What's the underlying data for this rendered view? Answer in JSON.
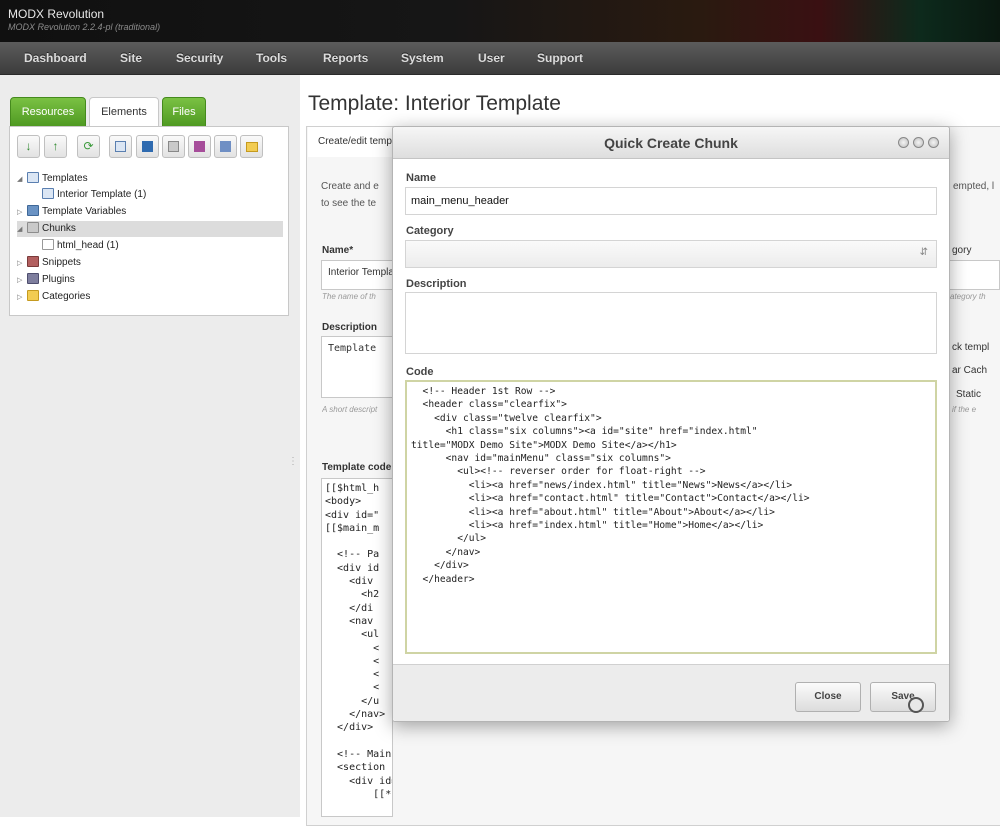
{
  "app": {
    "title": "MODX Revolution",
    "subtitle": "MODX Revolution 2.2.4-pl (traditional)"
  },
  "nav": {
    "items": [
      {
        "label": "Dashboard",
        "name": "nav-dashboard"
      },
      {
        "label": "Site",
        "name": "nav-site"
      },
      {
        "label": "Security",
        "name": "nav-security"
      },
      {
        "label": "Tools",
        "name": "nav-tools"
      },
      {
        "label": "Reports",
        "name": "nav-reports"
      },
      {
        "label": "System",
        "name": "nav-system"
      },
      {
        "label": "User",
        "name": "nav-user"
      },
      {
        "label": "Support",
        "name": "nav-support"
      }
    ]
  },
  "left": {
    "tabs": [
      {
        "label": "Resources",
        "active": false
      },
      {
        "label": "Elements",
        "active": true
      },
      {
        "label": "Files",
        "active": false
      }
    ],
    "toolbar_icons": [
      "arrow-down-icon",
      "arrow-up-icon",
      "refresh-icon",
      "new-template-icon",
      "new-tv-icon",
      "new-chunk-icon",
      "new-snippet-icon",
      "new-plugin-icon",
      "new-category-icon"
    ],
    "tree": [
      {
        "label": "Templates",
        "level": 0,
        "expanded": true,
        "icon": "template-folder-icon"
      },
      {
        "label": "Interior Template (1)",
        "level": 1,
        "icon": "template-icon"
      },
      {
        "label": "Template Variables",
        "level": 0,
        "expanded": false,
        "icon": "tv-icon"
      },
      {
        "label": "Chunks",
        "level": 0,
        "expanded": true,
        "icon": "chunk-icon",
        "selected": true
      },
      {
        "label": "html_head (1)",
        "level": 1,
        "icon": "document-icon"
      },
      {
        "label": "Snippets",
        "level": 0,
        "expanded": false,
        "icon": "snippet-icon"
      },
      {
        "label": "Plugins",
        "level": 0,
        "expanded": false,
        "icon": "plugin-icon"
      },
      {
        "label": "Categories",
        "level": 0,
        "expanded": false,
        "icon": "folder-icon"
      }
    ]
  },
  "main": {
    "page_title": "Template: Interior Template",
    "tab_label": "Create/edit template",
    "intro_left": "Create and e\nto see the te",
    "intro_right": "empted, l",
    "name_label": "Name*",
    "name_value": "Interior Template",
    "name_hint": "The name of th",
    "category_label": "gory",
    "category_hint": "ategory th",
    "description_label": "Description",
    "description_value": "Template",
    "description_hint": "A short descript",
    "lock_label": "ck templ",
    "cache_label": "ar Cach",
    "static_label": "Static",
    "static_hint": "if the e",
    "code_label": "Template code",
    "code_lines": "[[$html_h\n<body>\n<div id=\"\n[[$main_m\n\n  <!-- Pa\n  <div id\n    <div \n      <h2\n    </di\n    <nav \n      <ul\n        <\n        <\n        <\n        <\n      </u\n    </nav>\n  </div>\n\n  <!-- Main Content -->\n  <section id=\"main\" class=\"clearfix\">\n    <div id=\"pageContent\" class=\"seven columns\">\n        [[*content]]"
  },
  "modal": {
    "title": "Quick Create Chunk",
    "name_label": "Name",
    "name_value": "main_menu_header",
    "category_label": "Category",
    "category_value": "",
    "description_label": "Description",
    "description_value": "",
    "code_label": "Code",
    "code_value": "  <!-- Header 1st Row -->\n  <header class=\"clearfix\">\n    <div class=\"twelve clearfix\">\n      <h1 class=\"six columns\"><a id=\"site\" href=\"index.html\"\ntitle=\"MODX Demo Site\">MODX Demo Site</a></h1>\n      <nav id=\"mainMenu\" class=\"six columns\">\n        <ul><!-- reverser order for float-right -->\n          <li><a href=\"news/index.html\" title=\"News\">News</a></li>\n          <li><a href=\"contact.html\" title=\"Contact\">Contact</a></li>\n          <li><a href=\"about.html\" title=\"About\">About</a></li>\n          <li><a href=\"index.html\" title=\"Home\">Home</a></li>\n        </ul>\n      </nav>\n    </div>\n  </header>",
    "close_label": "Close",
    "save_label": "Save"
  }
}
